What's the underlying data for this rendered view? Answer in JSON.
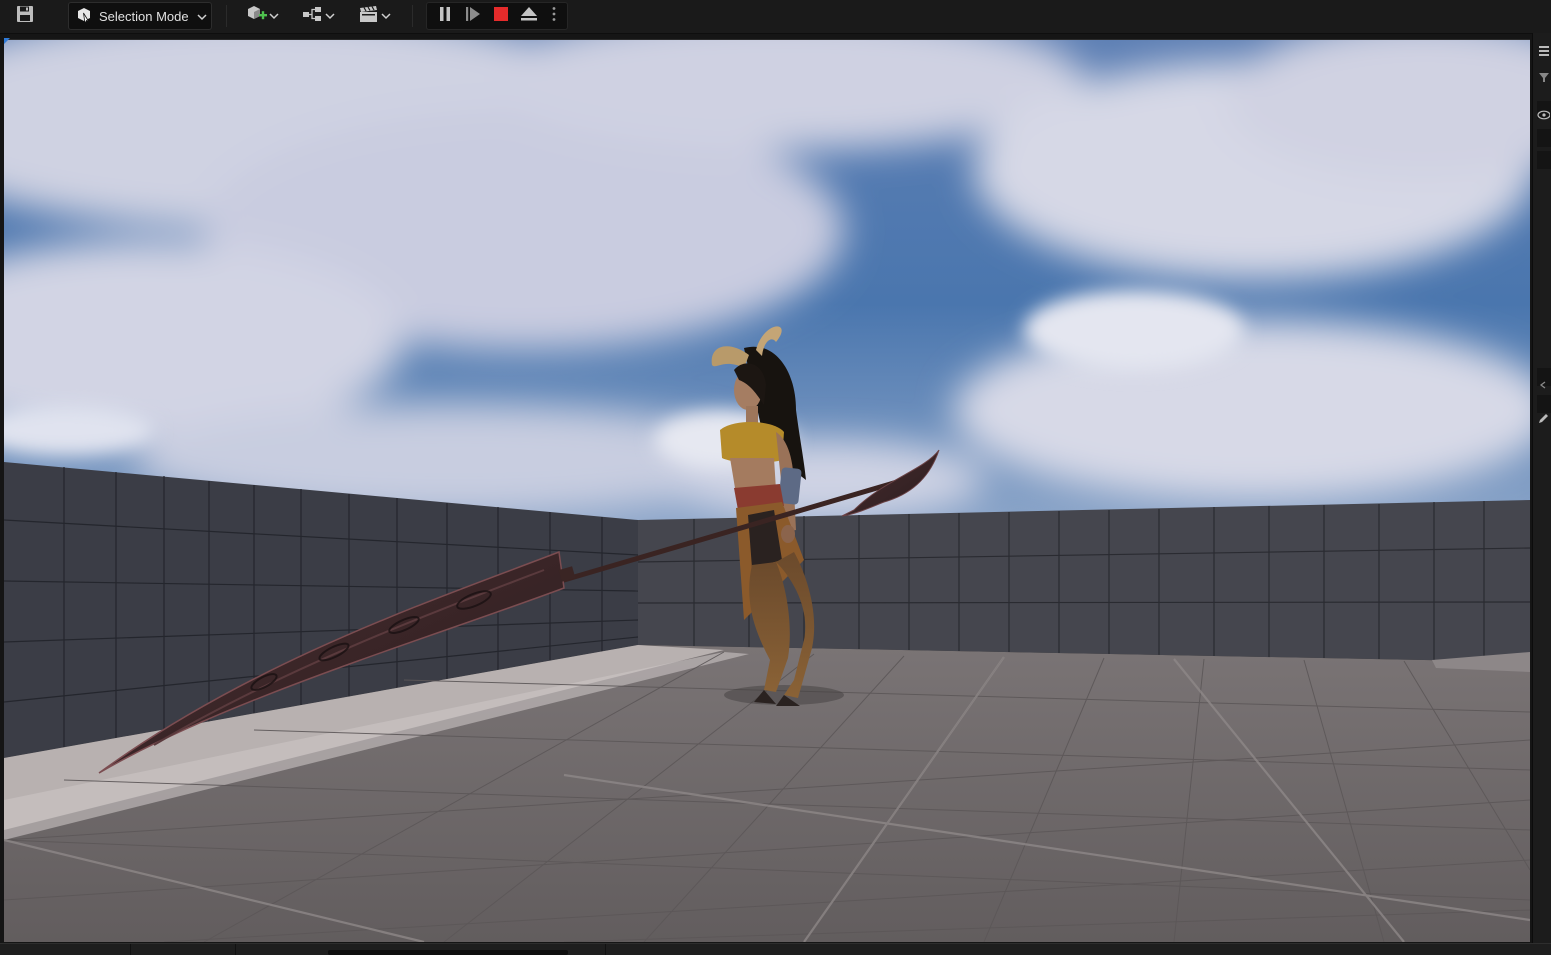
{
  "toolbar": {
    "save_icon": "save-icon",
    "mode_label": "Selection Mode",
    "add_icon": "add-actor-icon",
    "blueprint_icon": "blueprint-icon",
    "cinematics_icon": "clapperboard-icon",
    "play_controls": [
      "pause-icon",
      "frame-skip-icon",
      "stop-icon",
      "eject-icon",
      "more-options-icon"
    ]
  },
  "viewport": {
    "sky_color": "#4a76ae",
    "cloud_color": "#d4d7e6",
    "wall_color": "#3d3f48",
    "floor_color": "#6a6566",
    "walkway_color": "#b8b1b0",
    "stop_color": "#e52b2b",
    "accent": "#2f7bd8"
  }
}
